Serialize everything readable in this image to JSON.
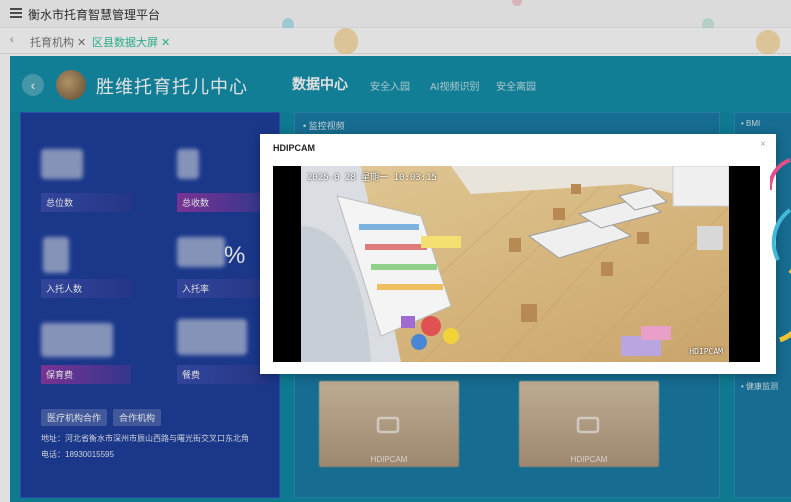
{
  "app": {
    "title": "衡水市托育智慧管理平台"
  },
  "tabs": [
    {
      "label": "托育机构",
      "close": "✕"
    },
    {
      "label": "区县数据大屏",
      "close": "✕"
    }
  ],
  "header": {
    "back": "‹",
    "org_name": "胜维托育托儿中心",
    "nav": [
      "数据中心",
      "安全入园",
      "AI视频识别",
      "安全离园"
    ]
  },
  "left_panel": {
    "stats": [
      {
        "label": "总位数"
      },
      {
        "label": "总收数"
      },
      {
        "label": "入托人数"
      },
      {
        "label": "入托率",
        "suffix": "%"
      },
      {
        "label": "保育费"
      },
      {
        "label": "餐费"
      }
    ],
    "buttons": [
      "医疗机构合作",
      "合作机构"
    ],
    "address": "地址：河北省衡水市深州市辰山西路与曙光街交叉口东北角",
    "phone": "电话：18930015595"
  },
  "mid_panel": {
    "title": "• 监控视频",
    "thumbnails": [
      {
        "label": "HDIPCAM"
      },
      {
        "label": "HDIPCAM"
      }
    ]
  },
  "right_panel": {
    "title_top": "• BMI",
    "title_bottom": "• 健康监测"
  },
  "modal": {
    "title": "HDIPCAM",
    "close": "×",
    "osd_timestamp": "2025-0  28 星期一 10:03:15",
    "osd_camera": "HDIPCAM"
  },
  "colors": {
    "dashboard_bg": "#128aa4",
    "panel_bg": "#1e3f9e",
    "active_tab": "#2ec4a0"
  }
}
